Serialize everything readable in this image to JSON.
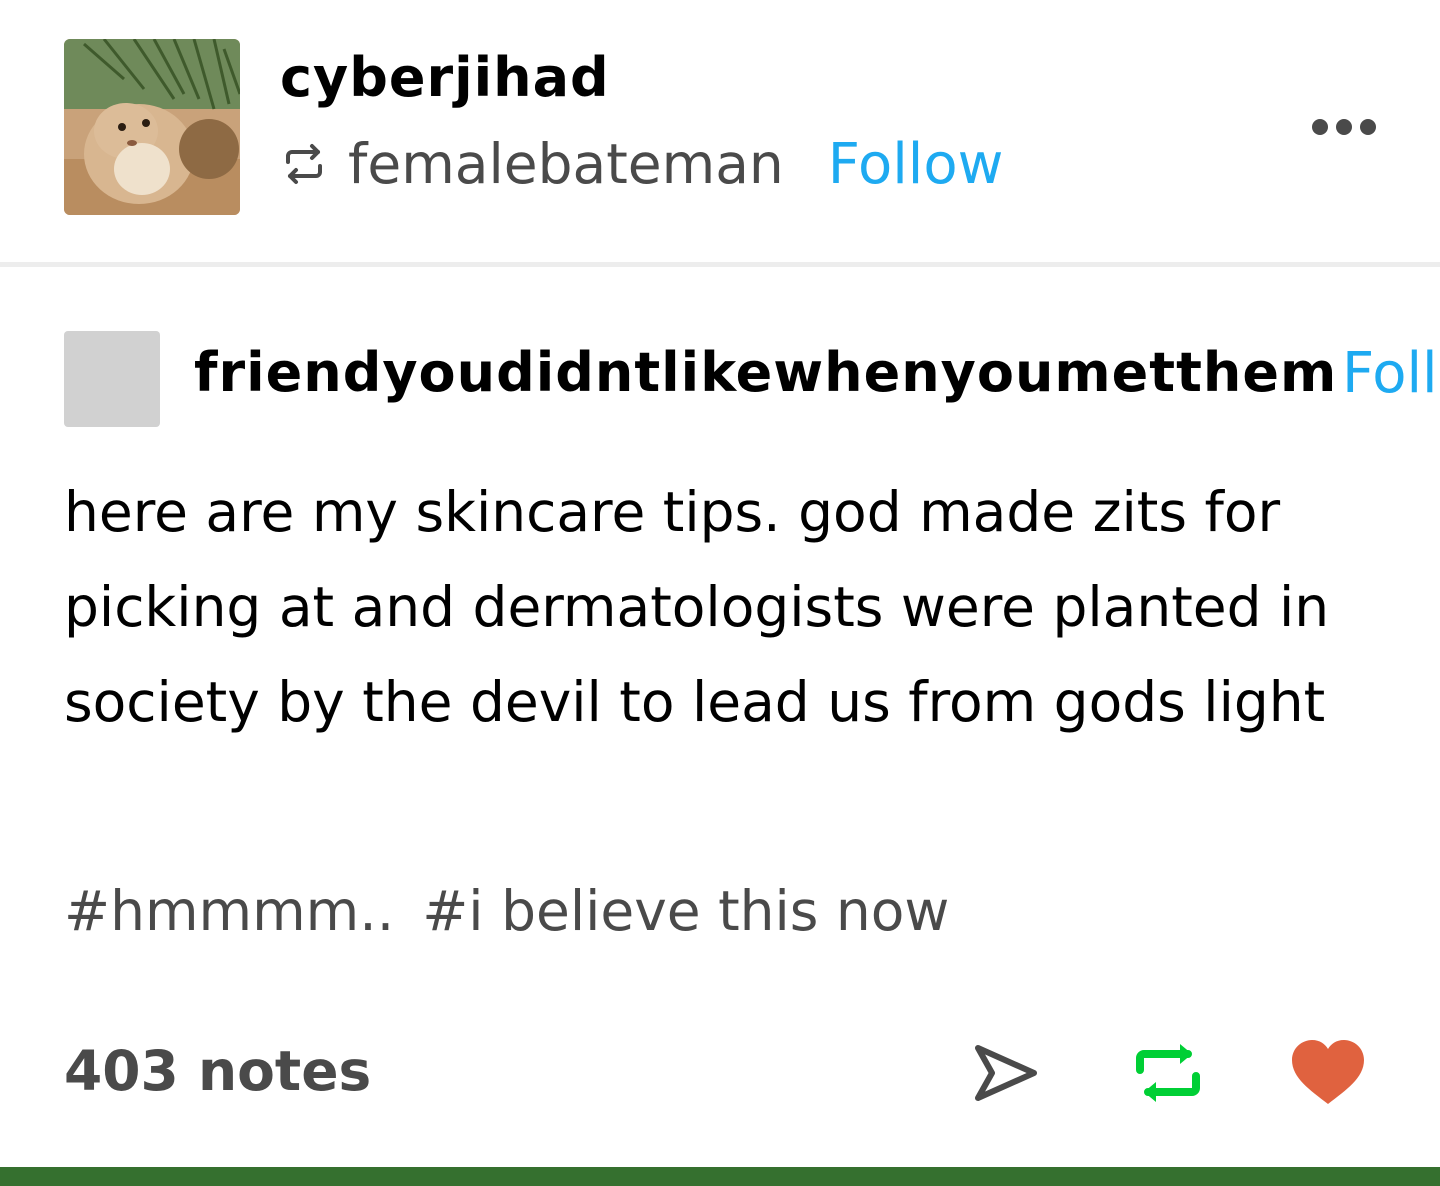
{
  "post": {
    "author": "cyberjihad",
    "reblogged_from": "femalebateman",
    "follow_label": "Follow",
    "more_icon": "ellipsis-icon",
    "reblog_icon": "reblog-icon"
  },
  "trail": {
    "username": "friendyoudidntlikewhenyoumetthem",
    "follow_label": "Foll",
    "body": "here are my skincare tips. god made zits for picking at and dermatologists were planted in society by the devil to lead us from gods light"
  },
  "tags": [
    "#hmmmm..",
    "#i believe this now"
  ],
  "footer": {
    "notes": "403 notes",
    "icons": [
      "share-icon",
      "reblog-icon",
      "heart-icon"
    ]
  },
  "colors": {
    "follow": "#1eaaf1",
    "secondary_text": "#4a4a4a",
    "reblog_active": "#00cf35",
    "like_active": "#e0623f",
    "bottom_bar": "#35702f",
    "divider": "#ededed",
    "placeholder_avatar": "#d1d1d1"
  }
}
